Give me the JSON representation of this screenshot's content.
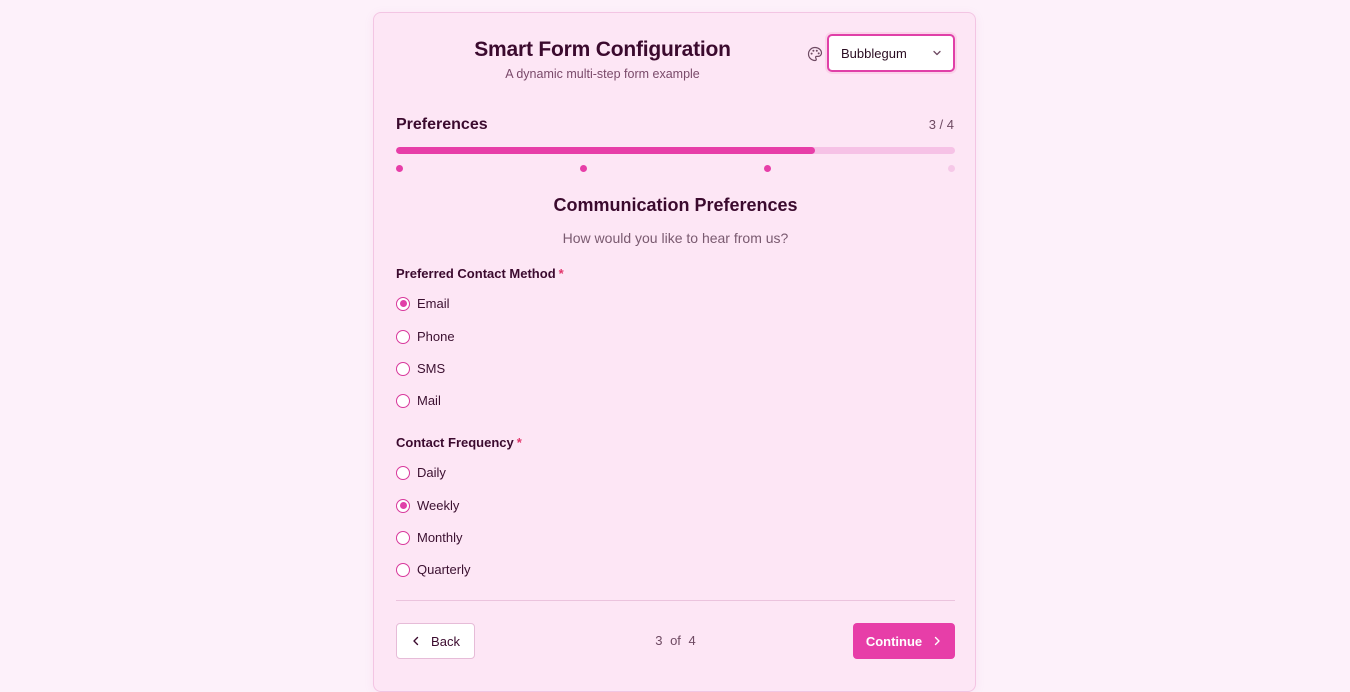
{
  "header": {
    "title": "Smart Form Configuration",
    "subtitle": "A dynamic multi-step form example"
  },
  "theme": {
    "selected": "Bubblegum",
    "icon": "palette-icon"
  },
  "step": {
    "title": "Preferences",
    "counter": "3 / 4",
    "current": 3,
    "total": 4,
    "progress_fraction": 0.75
  },
  "section": {
    "title": "Communication Preferences",
    "subtitle": "How would you like to hear from us?"
  },
  "contact_method": {
    "label": "Preferred Contact Method",
    "required_mark": "*",
    "options": [
      "Email",
      "Phone",
      "SMS",
      "Mail"
    ],
    "selected": "Email"
  },
  "contact_frequency": {
    "label": "Contact Frequency",
    "required_mark": "*",
    "options": [
      "Daily",
      "Weekly",
      "Monthly",
      "Quarterly"
    ],
    "selected": "Weekly"
  },
  "footer": {
    "back_label": "Back",
    "page_indicator": "3 of 4",
    "continue_label": "Continue"
  },
  "colors": {
    "accent": "#e73ea8",
    "card_bg": "#fde6f5",
    "page_bg": "#fdf1fa",
    "required": "#e2346a"
  }
}
